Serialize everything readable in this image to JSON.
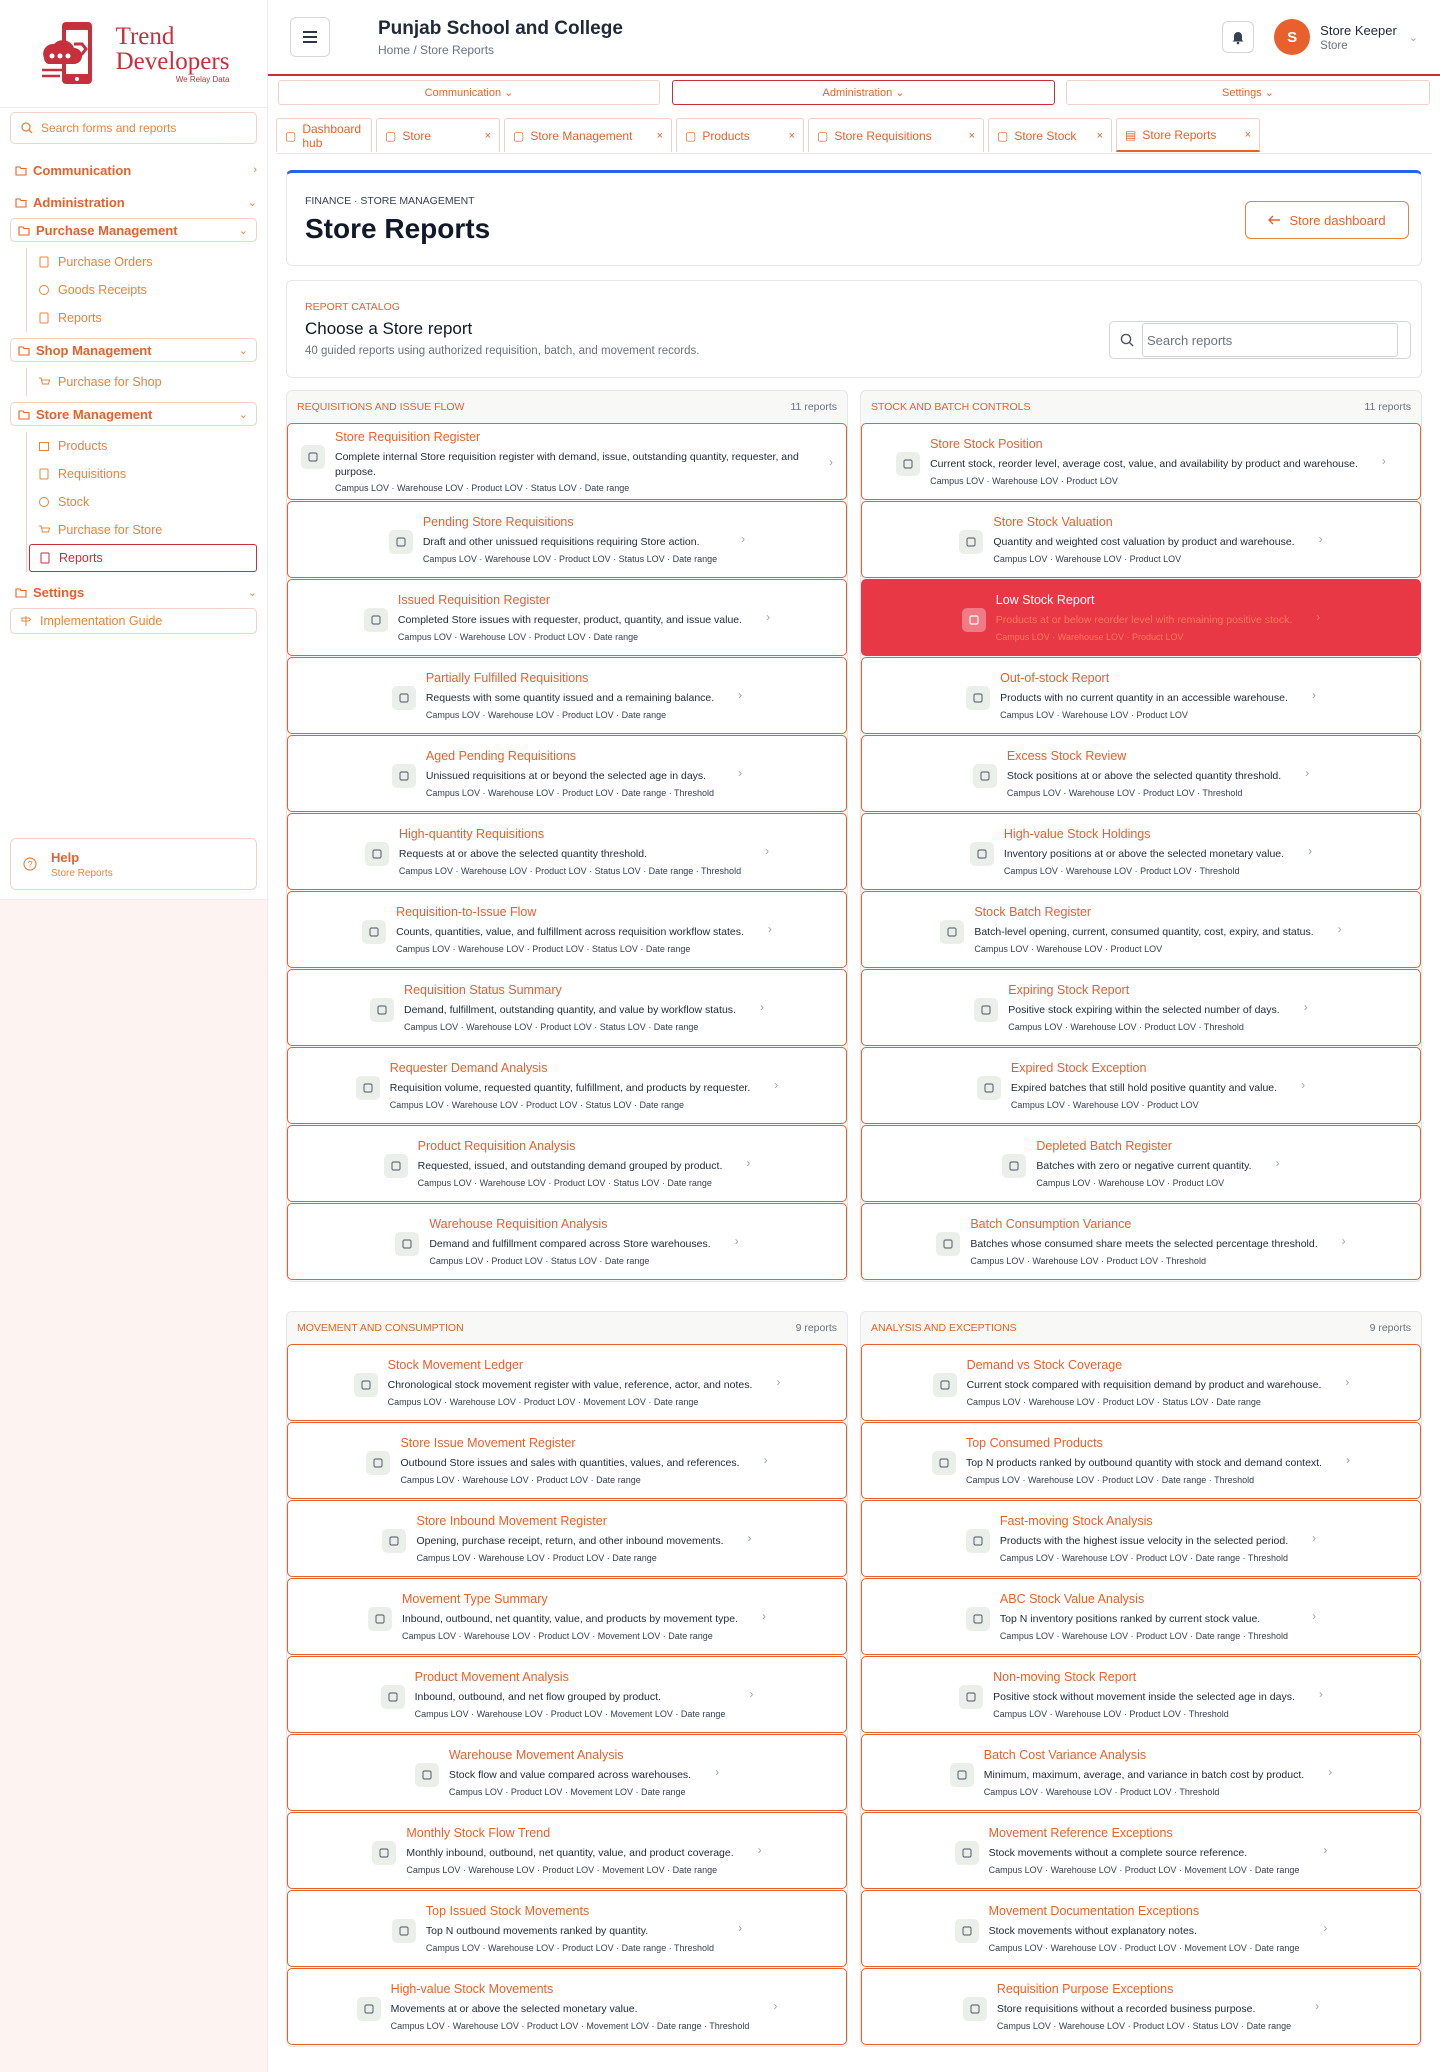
{
  "brand": {
    "line1": "Trend",
    "line2": "Developers",
    "tagline": "We Relay Data"
  },
  "sidebar": {
    "search_placeholder": "Search forms and reports",
    "communication": "Communication",
    "administration": "Administration",
    "purchase_management": "Purchase Management",
    "purchase_items": [
      "Purchase Orders",
      "Goods Receipts",
      "Reports"
    ],
    "shop_management": "Shop Management",
    "shop_items": [
      "Purchase for Shop"
    ],
    "store_management": "Store Management",
    "store_items": [
      "Products",
      "Requisitions",
      "Stock",
      "Purchase for Store",
      "Reports"
    ],
    "settings": "Settings",
    "implementation_guide": "Implementation Guide",
    "help_title": "Help",
    "help_subtitle": "Store Reports"
  },
  "header": {
    "school": "Punjab School and College",
    "breadcrumb": "Home / Store Reports",
    "user_initial": "S",
    "user_name": "Store Keeper",
    "user_role": "Store"
  },
  "menubar": {
    "communication": "Communication",
    "administration": "Administration",
    "settings": "Settings"
  },
  "tabs": [
    "Dashboard hub",
    "Store",
    "Store Management",
    "Products",
    "Store Requisitions",
    "Store Stock",
    "Store Reports"
  ],
  "page": {
    "eyebrow": "FINANCE · STORE MANAGEMENT",
    "title": "Store Reports",
    "dashboard_button": "Store dashboard"
  },
  "catalog": {
    "eyebrow": "REPORT CATALOG",
    "title": "Choose a Store report",
    "description": "40 guided reports using authorized requisition, batch, and movement records.",
    "search_placeholder": "Search reports"
  },
  "groups": [
    {
      "title": "Requisitions and Issue Flow",
      "count": "11 reports",
      "reports": [
        {
          "t": "Store Requisition Register",
          "d": "Complete internal Store requisition register with demand, issue, outstanding quantity, requester, and purpose.",
          "m": "Campus LOV · Warehouse LOV · Product LOV · Status LOV · Date range",
          "icon": "register-icon"
        },
        {
          "t": "Pending Store Requisitions",
          "d": "Draft and other unissued requisitions requiring Store action.",
          "m": "Campus LOV · Warehouse LOV · Product LOV · Status LOV · Date range",
          "icon": "hourglass-icon"
        },
        {
          "t": "Issued Requisition Register",
          "d": "Completed Store issues with requester, product, quantity, and issue value.",
          "m": "Campus LOV · Warehouse LOV · Product LOV · Date range",
          "icon": "issue-out-icon"
        },
        {
          "t": "Partially Fulfilled Requisitions",
          "d": "Requests with some quantity issued and a remaining balance.",
          "m": "Campus LOV · Warehouse LOV · Product LOV · Date range",
          "icon": "half-circle-icon"
        },
        {
          "t": "Aged Pending Requisitions",
          "d": "Unissued requisitions at or beyond the selected age in days.",
          "m": "Campus LOV · Warehouse LOV · Product LOV · Date range · Threshold",
          "icon": "timer-icon"
        },
        {
          "t": "High-quantity Requisitions",
          "d": "Requests at or above the selected quantity threshold.",
          "m": "Campus LOV · Warehouse LOV · Product LOV · Status LOV · Date range · Threshold",
          "icon": "sort-arrows-icon"
        },
        {
          "t": "Requisition-to-Issue Flow",
          "d": "Counts, quantities, value, and fulfillment across requisition workflow states.",
          "m": "Campus LOV · Warehouse LOV · Product LOV · Status LOV · Date range",
          "icon": "flow-icon"
        },
        {
          "t": "Requisition Status Summary",
          "d": "Demand, fulfillment, outstanding quantity, and value by workflow status.",
          "m": "Campus LOV · Warehouse LOV · Product LOV · Status LOV · Date range",
          "icon": "grid-icon"
        },
        {
          "t": "Requester Demand Analysis",
          "d": "Requisition volume, requested quantity, fulfillment, and products by requester.",
          "m": "Campus LOV · Warehouse LOV · Product LOV · Status LOV · Date range",
          "icon": "users-icon"
        },
        {
          "t": "Product Requisition Analysis",
          "d": "Requested, issued, and outstanding demand grouped by product.",
          "m": "Campus LOV · Warehouse LOV · Product LOV · Status LOV · Date range",
          "icon": "box-icon"
        },
        {
          "t": "Warehouse Requisition Analysis",
          "d": "Demand and fulfillment compared across Store warehouses.",
          "m": "Campus LOV · Product LOV · Status LOV · Date range",
          "icon": "warehouse-icon"
        }
      ]
    },
    {
      "title": "Stock and Batch Controls",
      "count": "11 reports",
      "reports": [
        {
          "t": "Store Stock Position",
          "d": "Current stock, reorder level, average cost, value, and availability by product and warehouse.",
          "m": "Campus LOV · Warehouse LOV · Product LOV",
          "icon": "stack-icon"
        },
        {
          "t": "Store Stock Valuation",
          "d": "Quantity and weighted cost valuation by product and warehouse.",
          "m": "Campus LOV · Warehouse LOV · Product LOV",
          "icon": "cash-icon"
        },
        {
          "t": "Low Stock Report",
          "d": "Products at or below reorder level with remaining positive stock.",
          "m": "Campus LOV · Warehouse LOV · Product LOV",
          "icon": "warning-icon"
        },
        {
          "t": "Out-of-stock Report",
          "d": "Products with no current quantity in an accessible warehouse.",
          "m": "Campus LOV · Warehouse LOV · Product LOV",
          "icon": "x-circle-icon"
        },
        {
          "t": "Excess Stock Review",
          "d": "Stock positions at or above the selected quantity threshold.",
          "m": "Campus LOV · Warehouse LOV · Product LOV · Threshold",
          "icon": "stack-icon"
        },
        {
          "t": "High-value Stock Holdings",
          "d": "Inventory positions at or above the selected monetary value.",
          "m": "Campus LOV · Warehouse LOV · Product LOV · Threshold",
          "icon": "diamond-icon"
        },
        {
          "t": "Stock Batch Register",
          "d": "Batch-level opening, current, consumed quantity, cost, expiry, and status.",
          "m": "Campus LOV · Warehouse LOV · Product LOV",
          "icon": "batch-icon"
        },
        {
          "t": "Expiring Stock Report",
          "d": "Positive stock expiring within the selected number of days.",
          "m": "Campus LOV · Warehouse LOV · Product LOV · Threshold",
          "icon": "calendar-icon"
        },
        {
          "t": "Expired Stock Exception",
          "d": "Expired batches that still hold positive quantity and value.",
          "m": "Campus LOV · Warehouse LOV · Product LOV",
          "icon": "calendar-x-icon"
        },
        {
          "t": "Depleted Batch Register",
          "d": "Batches with zero or negative current quantity.",
          "m": "Campus LOV · Warehouse LOV · Product LOV",
          "icon": "battery-icon"
        },
        {
          "t": "Batch Consumption Variance",
          "d": "Batches whose consumed share meets the selected percentage threshold.",
          "m": "Campus LOV · Warehouse LOV · Product LOV · Threshold",
          "icon": "percent-icon"
        }
      ]
    },
    {
      "title": "Movement and Consumption",
      "count": "9 reports",
      "reports": [
        {
          "t": "Stock Movement Ledger",
          "d": "Chronological stock movement register with value, reference, actor, and notes.",
          "m": "Campus LOV · Warehouse LOV · Product LOV · Movement LOV · Date range",
          "icon": "list-icon"
        },
        {
          "t": "Store Issue Movement Register",
          "d": "Outbound Store issues and sales with quantities, values, and references.",
          "m": "Campus LOV · Warehouse LOV · Product LOV · Date range",
          "icon": "export-icon"
        },
        {
          "t": "Store Inbound Movement Register",
          "d": "Opening, purchase receipt, return, and other inbound movements.",
          "m": "Campus LOV · Warehouse LOV · Product LOV · Date range",
          "icon": "import-icon"
        },
        {
          "t": "Movement Type Summary",
          "d": "Inbound, outbound, net quantity, value, and products by movement type.",
          "m": "Campus LOV · Warehouse LOV · Product LOV · Movement LOV · Date range",
          "icon": "swap-icon"
        },
        {
          "t": "Product Movement Analysis",
          "d": "Inbound, outbound, and net flow grouped by product.",
          "m": "Campus LOV · Warehouse LOV · Product LOV · Movement LOV · Date range",
          "icon": "line-chart-icon"
        },
        {
          "t": "Warehouse Movement Analysis",
          "d": "Stock flow and value compared across warehouses.",
          "m": "Campus LOV · Product LOV · Movement LOV · Date range",
          "icon": "building-icon"
        },
        {
          "t": "Monthly Stock Flow Trend",
          "d": "Monthly inbound, outbound, net quantity, value, and product coverage.",
          "m": "Campus LOV · Warehouse LOV · Product LOV · Movement LOV · Date range",
          "icon": "pulse-icon"
        },
        {
          "t": "Top Issued Stock Movements",
          "d": "Top N outbound movements ranked by quantity.",
          "m": "Campus LOV · Warehouse LOV · Product LOV · Date range · Threshold",
          "icon": "sort-down-icon"
        },
        {
          "t": "High-value Stock Movements",
          "d": "Movements at or above the selected monetary value.",
          "m": "Campus LOV · Warehouse LOV · Product LOV · Movement LOV · Date range · Threshold",
          "icon": "coins-icon"
        }
      ]
    },
    {
      "title": "Analysis and Exceptions",
      "count": "9 reports",
      "reports": [
        {
          "t": "Demand vs Stock Coverage",
          "d": "Current stock compared with requisition demand by product and warehouse.",
          "m": "Campus LOV · Warehouse LOV · Product LOV · Status LOV · Date range",
          "icon": "gauge-icon"
        },
        {
          "t": "Top Consumed Products",
          "d": "Top N products ranked by outbound quantity with stock and demand context.",
          "m": "Campus LOV · Warehouse LOV · Product LOV · Date range · Threshold",
          "icon": "bar-chart-icon"
        },
        {
          "t": "Fast-moving Stock Analysis",
          "d": "Products with the highest issue velocity in the selected period.",
          "m": "Campus LOV · Warehouse LOV · Product LOV · Date range · Threshold",
          "icon": "bolt-icon"
        },
        {
          "t": "ABC Stock Value Analysis",
          "d": "Top N inventory positions ranked by current stock value.",
          "m": "Campus LOV · Warehouse LOV · Product LOV · Date range · Threshold",
          "icon": "pie-icon"
        },
        {
          "t": "Non-moving Stock Report",
          "d": "Positive stock without movement inside the selected age in days.",
          "m": "Campus LOV · Warehouse LOV · Product LOV · Threshold",
          "icon": "moon-icon"
        },
        {
          "t": "Batch Cost Variance Analysis",
          "d": "Minimum, maximum, average, and variance in batch cost by product.",
          "m": "Campus LOV · Warehouse LOV · Product LOV · Threshold",
          "icon": "trend-icon"
        },
        {
          "t": "Movement Reference Exceptions",
          "d": "Stock movements without a complete source reference.",
          "m": "Campus LOV · Warehouse LOV · Product LOV · Movement LOV · Date range",
          "icon": "link-icon"
        },
        {
          "t": "Movement Documentation Exceptions",
          "d": "Stock movements without explanatory notes.",
          "m": "Campus LOV · Warehouse LOV · Product LOV · Movement LOV · Date range",
          "icon": "document-icon"
        },
        {
          "t": "Requisition Purpose Exceptions",
          "d": "Store requisitions without a recorded business purpose.",
          "m": "Campus LOV · Warehouse LOV · Product LOV · Status LOV · Date range",
          "icon": "clipboard-icon"
        }
      ]
    }
  ],
  "highlighted_report": "Low Stock Report",
  "colors": {
    "accent": "#e8612c",
    "brand_red": "#c62f3c",
    "highlight": "#e83745",
    "link_blue": "#2563eb"
  }
}
